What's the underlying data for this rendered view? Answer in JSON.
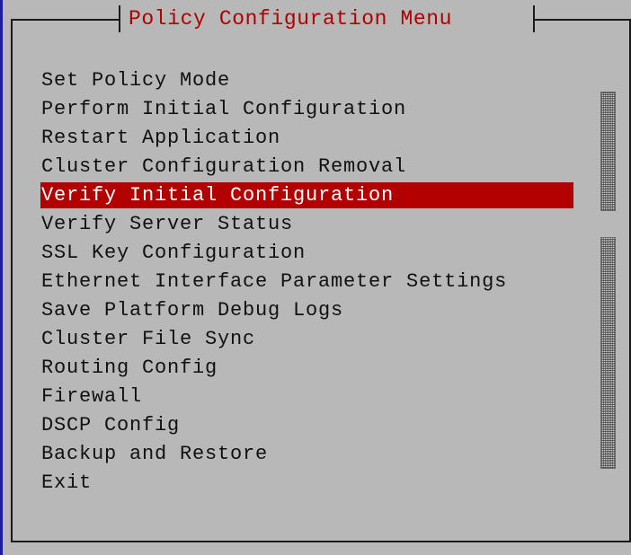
{
  "dialog": {
    "title": "Policy Configuration Menu"
  },
  "menu": {
    "selected_index": 4,
    "items": [
      {
        "label": "Set Policy Mode"
      },
      {
        "label": "Perform Initial Configuration"
      },
      {
        "label": "Restart Application"
      },
      {
        "label": "Cluster Configuration Removal"
      },
      {
        "label": "Verify Initial Configuration"
      },
      {
        "label": "Verify Server Status"
      },
      {
        "label": "SSL Key Configuration"
      },
      {
        "label": "Ethernet Interface Parameter Settings"
      },
      {
        "label": "Save Platform Debug Logs"
      },
      {
        "label": "Cluster File Sync"
      },
      {
        "label": "Routing Config"
      },
      {
        "label": "Firewall"
      },
      {
        "label": "DSCP Config"
      },
      {
        "label": "Backup and Restore"
      },
      {
        "label": "Exit"
      }
    ]
  },
  "colors": {
    "background": "#b8b8b8",
    "title_text": "#b00000",
    "selection_bg": "#b30000",
    "selection_text": "#ffffff",
    "frame": "#1a1a1a"
  }
}
